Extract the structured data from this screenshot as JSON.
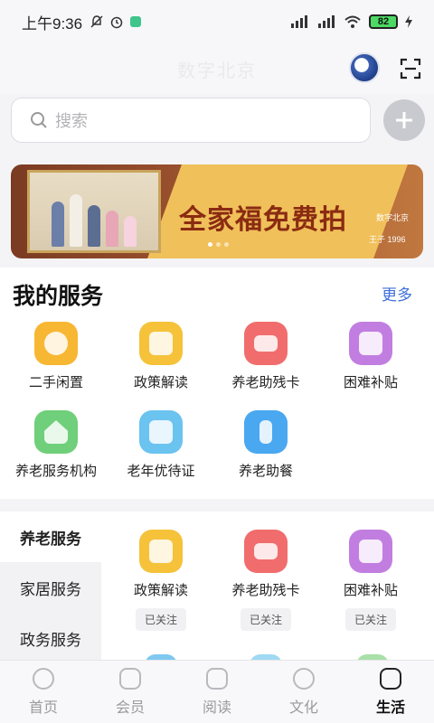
{
  "status_bar": {
    "time": "上午9:36",
    "battery": "82"
  },
  "header": {
    "title": "数字北京"
  },
  "search": {
    "placeholder": "搜索"
  },
  "banner": {
    "headline": "全家福免费拍",
    "brand": "数字北京",
    "brand2": "王子 1996"
  },
  "my_services": {
    "title": "我的服务",
    "more": "更多",
    "items": [
      {
        "label": "二手闲置",
        "icon": "idle-goods-icon",
        "color": "#f7b733"
      },
      {
        "label": "政策解读",
        "icon": "policy-book-icon",
        "color": "#f5c23a"
      },
      {
        "label": "养老助残卡",
        "icon": "card-icon",
        "color": "#f16d6d"
      },
      {
        "label": "困难补贴",
        "icon": "subsidy-icon",
        "color": "#c17ee0"
      },
      {
        "label": "养老服务机构",
        "icon": "house-icon",
        "color": "#6fcf7a"
      },
      {
        "label": "老年优待证",
        "icon": "certificate-icon",
        "color": "#6bc3f0"
      },
      {
        "label": "养老助餐",
        "icon": "meal-icon",
        "color": "#4aa8f0"
      }
    ]
  },
  "side_nav": {
    "items": [
      {
        "label": "养老服务"
      },
      {
        "label": "家居服务"
      },
      {
        "label": "政务服务"
      }
    ]
  },
  "follow_cards": {
    "items": [
      {
        "label": "政策解读",
        "status": "已关注",
        "color": "#f5c23a"
      },
      {
        "label": "养老助残卡",
        "status": "已关注",
        "color": "#f16d6d"
      },
      {
        "label": "困难补贴",
        "status": "已关注",
        "color": "#c17ee0"
      }
    ]
  },
  "tabbar": {
    "items": [
      {
        "label": "首页"
      },
      {
        "label": "会员"
      },
      {
        "label": "阅读"
      },
      {
        "label": "文化"
      },
      {
        "label": "生活"
      }
    ]
  }
}
